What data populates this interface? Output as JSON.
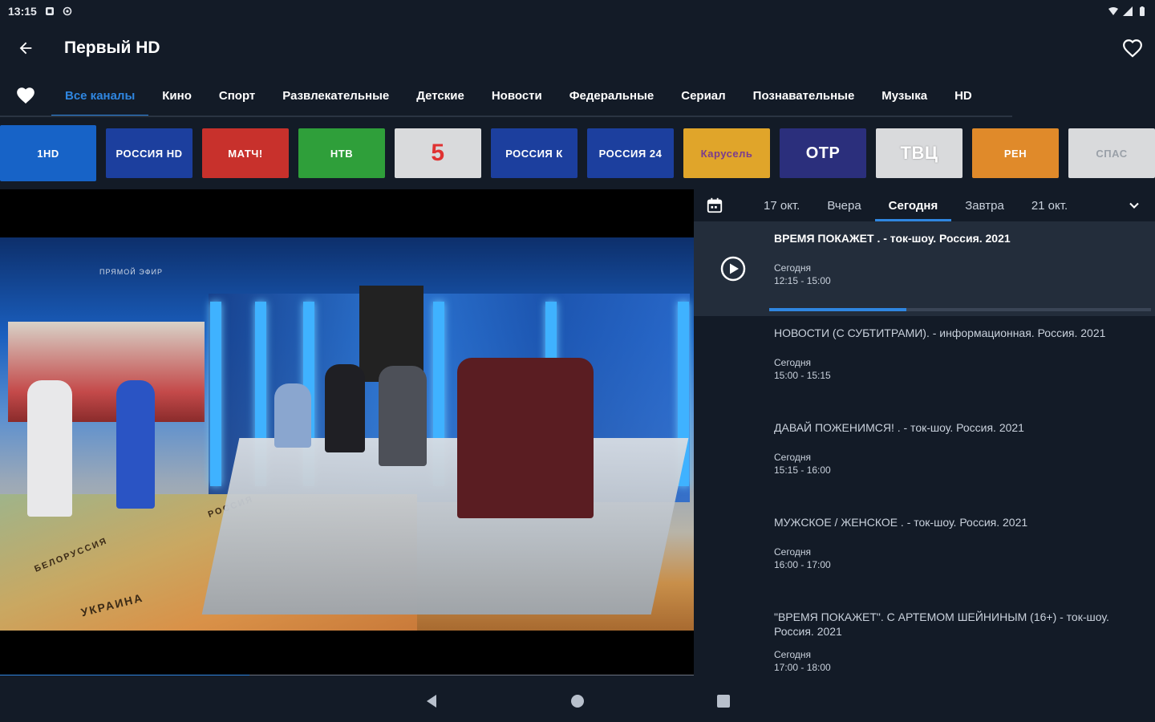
{
  "status_bar": {
    "time": "13:15"
  },
  "app_bar": {
    "title": "Первый HD"
  },
  "categories": [
    {
      "label": "Все каналы",
      "active": true
    },
    {
      "label": "Кино"
    },
    {
      "label": "Спорт"
    },
    {
      "label": "Развлекательные"
    },
    {
      "label": "Детские"
    },
    {
      "label": "Новости"
    },
    {
      "label": "Федеральные"
    },
    {
      "label": "Сериал"
    },
    {
      "label": "Познавательные"
    },
    {
      "label": "Музыка"
    },
    {
      "label": "HD"
    }
  ],
  "channels": [
    {
      "logo_text": "1HD",
      "bg": "#1763c7",
      "fg": "#ffffff"
    },
    {
      "logo_text": "РОССИЯ HD",
      "bg": "#1c3f9e",
      "fg": "#ffffff"
    },
    {
      "logo_text": "МАТЧ!",
      "bg": "#c8312c",
      "fg": "#ffffff"
    },
    {
      "logo_text": "НТВ",
      "bg": "#2f9f3a",
      "fg": "#ffffff"
    },
    {
      "logo_text": "5",
      "bg": "#d9dadc",
      "fg": "#e03232"
    },
    {
      "logo_text": "РОССИЯ К",
      "bg": "#1c3f9e",
      "fg": "#ffffff"
    },
    {
      "logo_text": "РОССИЯ 24",
      "bg": "#1c3f9e",
      "fg": "#ffffff"
    },
    {
      "logo_text": "Карусель",
      "bg": "#e0a52a",
      "fg": "#7a3c8f"
    },
    {
      "logo_text": "ОТР",
      "bg": "#2b2f7c",
      "fg": "#ffffff"
    },
    {
      "logo_text": "ТВЦ",
      "bg": "#d9dadc",
      "fg": "#ffffff"
    },
    {
      "logo_text": "РЕН",
      "bg": "#e08a2a",
      "fg": "#ffffff"
    },
    {
      "logo_text": "СПАС",
      "bg": "#d9dadc",
      "fg": "#9aa0a8"
    }
  ],
  "video": {
    "live_tag": "ПРЯМОЙ ЭФИР",
    "map_labels": [
      "УКРАИНА",
      "БЕЛОРУССИЯ",
      "РОССИЯ"
    ],
    "progress": 0.36
  },
  "epg": {
    "days": [
      {
        "label": "17 окт."
      },
      {
        "label": "Вчера"
      },
      {
        "label": "Сегодня",
        "active": true
      },
      {
        "label": "Завтра"
      },
      {
        "label": "21 окт."
      }
    ],
    "programs": [
      {
        "title": "ВРЕМЯ ПОКАЖЕТ . - ток-шоу. Россия. 2021",
        "day": "Сегодня",
        "time": "12:15 - 15:00",
        "current": true,
        "progress": 0.36
      },
      {
        "title": "НОВОСТИ (С СУБТИТРАМИ). - информационная. Россия. 2021",
        "day": "Сегодня",
        "time": "15:00 - 15:15"
      },
      {
        "title": "ДАВАЙ ПОЖЕНИМСЯ! . - ток-шоу. Россия. 2021",
        "day": "Сегодня",
        "time": "15:15 - 16:00"
      },
      {
        "title": "МУЖСКОЕ / ЖЕНСКОЕ . - ток-шоу. Россия. 2021",
        "day": "Сегодня",
        "time": "16:00 - 17:00"
      },
      {
        "title": "\"ВРЕМЯ ПОКАЖЕТ\". С АРТЕМОМ ШЕЙНИНЫМ (16+) - ток-шоу. Россия. 2021",
        "day": "Сегодня",
        "time": "17:00 - 18:00"
      }
    ]
  },
  "colors": {
    "accent": "#2f86e0",
    "background": "#131b27",
    "current_row": "#232d3b"
  },
  "icons": {
    "back": "arrow-left-icon",
    "favorite": "heart-outline-icon",
    "favorites_tab": "heart-filled-icon",
    "calendar": "calendar-icon",
    "expand": "chevron-down-icon",
    "play": "play-circle-icon"
  }
}
